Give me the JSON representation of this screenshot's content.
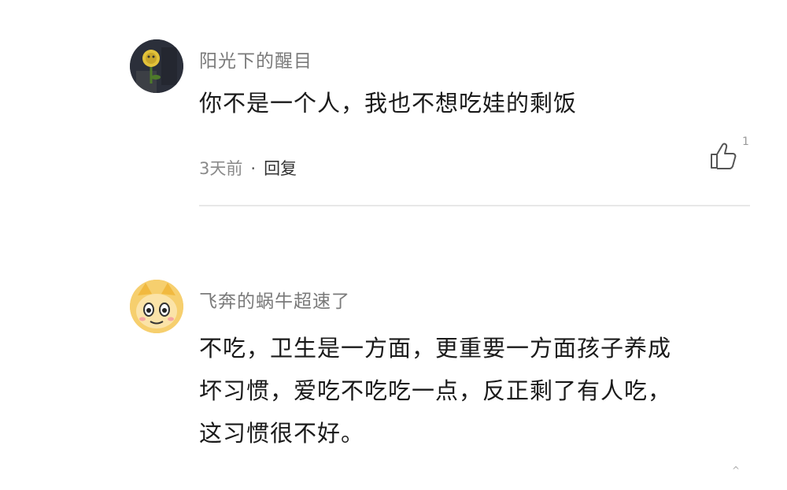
{
  "comments": [
    {
      "username": "阳光下的醒目",
      "text_lines": [
        "你不是一个人，我也不想吃娃的剩饭"
      ],
      "time": "3天前",
      "separator": "·",
      "reply_label": "回复",
      "like_count": "1",
      "avatar_icon": "flower-avatar-icon"
    },
    {
      "username": "飞奔的蜗牛超速了",
      "text_lines": [
        "不吃，卫生是一方面，更重要一方面孩子养成",
        "坏习惯，爱吃不吃吃一点，反正剩了有人吃，",
        "这习惯很不好。"
      ],
      "avatar_icon": "cartoon-face-avatar-icon"
    }
  ],
  "scroll_indicator": "^",
  "colors": {
    "username": "#7a7a7a",
    "body_text": "#1a1a1a",
    "meta_time": "#8a8a8a",
    "divider": "#e8e8e8",
    "avatar1_bg": "#2b2f3a",
    "avatar2_bg": "#f4c25a"
  }
}
